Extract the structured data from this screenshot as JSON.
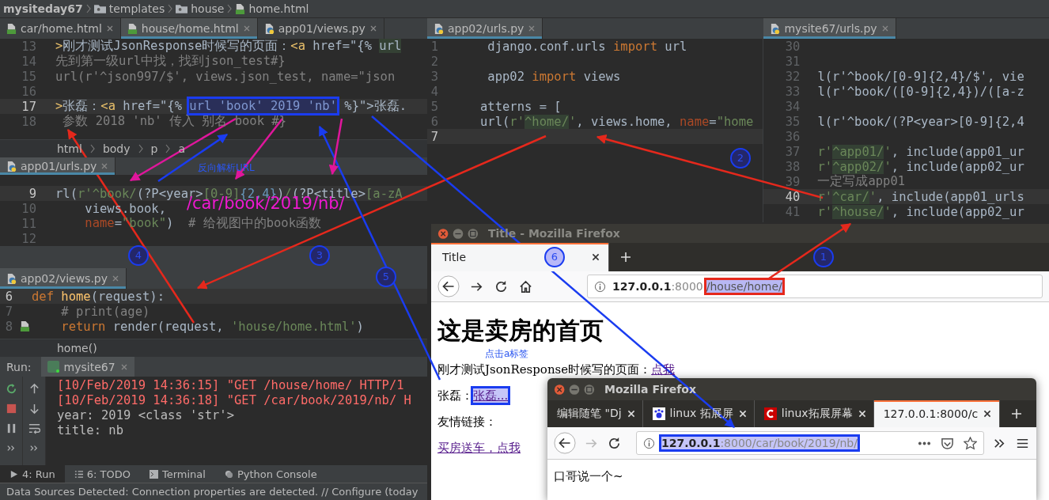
{
  "breadcrumb": [
    "mysiteday67",
    "templates",
    "house",
    "home.html"
  ],
  "editors": [
    {
      "tabs": [
        {
          "label": "car/home.html",
          "selected": false
        },
        {
          "label": "house/home.html",
          "selected": true
        },
        {
          "label": "app01/views.py",
          "selected": false
        }
      ],
      "lines": [
        {
          "num": "13",
          "current": false,
          "segments": [
            {
              "text": ">",
              "kind": "tag"
            },
            {
              "text": "刚才测试JsonResponse时候写的页面：",
              "kind": "text"
            },
            {
              "text": "<a",
              "kind": "tag"
            },
            {
              "text": " href=\"{% ",
              "kind": "text"
            },
            {
              "text": "url",
              "kind": "hl"
            }
          ]
        },
        {
          "num": "14",
          "current": false,
          "segments": [
            {
              "text": "先到第一级url中找，找到json_test#}",
              "kind": "cmt"
            }
          ]
        },
        {
          "num": "15",
          "current": false,
          "segments": [
            {
              "text": "url(r'^json997/$', views.json_test, name=\"json",
              "kind": "cmt"
            }
          ]
        },
        {
          "num": "16",
          "current": false
        },
        {
          "num": "17",
          "current": true,
          "segments": [
            {
              "text": ">",
              "kind": "tag"
            },
            {
              "text": "张磊：",
              "kind": "text"
            },
            {
              "text": "<a",
              "kind": "tag"
            },
            {
              "text": " href=\"{% ",
              "kind": "text"
            },
            {
              "text": "url 'book' 2019 'nb'",
              "kind": "hl",
              "boxed": true
            },
            {
              "text": " %}\">张磊.",
              "kind": "text"
            }
          ]
        },
        {
          "num": "18",
          "current": false,
          "segments": [
            {
              "text": " 参数 2018 'nb' 传入 别名 book #}",
              "kind": "cmt"
            }
          ]
        }
      ],
      "path": [
        "html",
        "body",
        "p",
        "a"
      ]
    },
    {
      "tabs": [
        {
          "label": "app01/urls.py",
          "selected": true
        }
      ],
      "lines": [
        {
          "num": "9",
          "current": true,
          "segments": [
            {
              "text": "rl(",
              "kind": "text"
            },
            {
              "text": "r'^book/",
              "kind": "str"
            },
            {
              "text": "(?P<year>",
              "kind": "text"
            },
            {
              "text": "[0-9]",
              "kind": "str"
            },
            {
              "text": "{2,4}",
              "kind": "num"
            },
            {
              "text": ")",
              "kind": "text"
            },
            {
              "text": "/",
              "kind": "str"
            },
            {
              "text": "(?P<title>",
              "kind": "text"
            },
            {
              "text": "[a-zA",
              "kind": "str"
            }
          ]
        },
        {
          "num": "10",
          "current": false,
          "segments": [
            {
              "text": "    views.book,",
              "kind": "text"
            }
          ]
        },
        {
          "num": "11",
          "current": false,
          "segments": [
            {
              "text": "    name",
              "kind": "param"
            },
            {
              "text": "=",
              "kind": "text"
            },
            {
              "text": "\"book\"",
              "kind": "str"
            },
            {
              "text": ")  ",
              "kind": "text"
            },
            {
              "text": "# 给视图中的book函数",
              "kind": "cmt"
            }
          ]
        },
        {
          "num": "12",
          "current": false
        }
      ]
    },
    {
      "tabs": [
        {
          "label": "app02/views.py",
          "selected": true
        }
      ],
      "lines": [
        {
          "num": "6",
          "current": true,
          "segments": [
            {
              "text": "def ",
              "kind": "kw"
            },
            {
              "text": "home",
              "kind": "fn"
            },
            {
              "text": "(request):",
              "kind": "text"
            }
          ]
        },
        {
          "num": "7",
          "current": false,
          "segments": [
            {
              "text": "    # print(age)",
              "kind": "cmt"
            }
          ]
        },
        {
          "num": "8",
          "current": false,
          "segments": [
            {
              "text": "    return ",
              "kind": "kw"
            },
            {
              "text": "render(request, ",
              "kind": "text"
            },
            {
              "text": "'house/home.html'",
              "kind": "str"
            },
            {
              "text": ")",
              "kind": "text"
            }
          ]
        }
      ],
      "footer": "home()"
    },
    {
      "tabs": [
        {
          "label": "app02/urls.py",
          "selected": true
        }
      ],
      "lines": [
        {
          "num": "1",
          "current": false,
          "segments": [
            {
              "text": " django.conf.urls ",
              "kind": "text"
            },
            {
              "text": "import",
              "kind": "kw"
            },
            {
              "text": " url",
              "kind": "text"
            }
          ]
        },
        {
          "num": "2",
          "current": false
        },
        {
          "num": "3",
          "current": false,
          "segments": [
            {
              "text": " app02 ",
              "kind": "text"
            },
            {
              "text": "import",
              "kind": "kw"
            },
            {
              "text": " views",
              "kind": "text"
            }
          ]
        },
        {
          "num": "4",
          "current": false
        },
        {
          "num": "5",
          "current": false,
          "segments": [
            {
              "text": "atterns = [",
              "kind": "text"
            }
          ]
        },
        {
          "num": "6",
          "current": false,
          "segments": [
            {
              "text": "url(",
              "kind": "text"
            },
            {
              "text": "r'",
              "kind": "str"
            },
            {
              "text": "^home/",
              "kind": "strhl"
            },
            {
              "text": "'",
              "kind": "str"
            },
            {
              "text": ", views.home, ",
              "kind": "text"
            },
            {
              "text": "name",
              "kind": "param"
            },
            {
              "text": "=",
              "kind": "text"
            },
            {
              "text": "\"home",
              "kind": "str"
            }
          ]
        },
        {
          "num": "7",
          "current": true
        }
      ]
    },
    {
      "tabs": [
        {
          "label": "mysite67/urls.py",
          "selected": true
        }
      ],
      "lines": [
        {
          "num": "30",
          "current": false
        },
        {
          "num": "31",
          "current": false
        },
        {
          "num": "32",
          "current": false,
          "segments": [
            {
              "text": "l(r'^book/[0-9]{2,4}/$', vie",
              "kind": "text"
            }
          ]
        },
        {
          "num": "33",
          "current": false,
          "segments": [
            {
              "text": "l(r'^book/([0-9]{2,4})/([a-z",
              "kind": "text"
            }
          ]
        },
        {
          "num": "34",
          "current": false
        },
        {
          "num": "35",
          "current": false,
          "segments": [
            {
              "text": "l(r'^book/(?P<year>[0-9]{2,4",
              "kind": "text"
            }
          ]
        },
        {
          "num": "36",
          "current": false
        },
        {
          "num": "37",
          "current": false,
          "segments": [
            {
              "text": "r'",
              "kind": "str"
            },
            {
              "text": "^app01/",
              "kind": "strhl"
            },
            {
              "text": "'",
              "kind": "str"
            },
            {
              "text": ", include(app01_ur",
              "kind": "text"
            }
          ]
        },
        {
          "num": "38",
          "current": false,
          "segments": [
            {
              "text": "r'",
              "kind": "str"
            },
            {
              "text": "^app02/",
              "kind": "strhl"
            },
            {
              "text": "'",
              "kind": "str"
            },
            {
              "text": ", include(app02_ur",
              "kind": "text"
            }
          ]
        },
        {
          "num": "39",
          "current": false,
          "segments": [
            {
              "text": "一定写成app01",
              "kind": "cmt"
            }
          ]
        },
        {
          "num": "40",
          "current": true,
          "segments": [
            {
              "text": "r'",
              "kind": "str"
            },
            {
              "text": "^car/",
              "kind": "strhl"
            },
            {
              "text": "'",
              "kind": "str"
            },
            {
              "text": ", include(app01_urls",
              "kind": "text"
            }
          ]
        },
        {
          "num": "41",
          "current": false,
          "segments": [
            {
              "text": "r'",
              "kind": "str"
            },
            {
              "text": "^house/",
              "kind": "strhl"
            },
            {
              "text": "'",
              "kind": "str"
            },
            {
              "text": ", include(app02_ur",
              "kind": "text"
            }
          ]
        }
      ]
    }
  ],
  "run": {
    "label": "Run:",
    "tab": "mysite67",
    "console": [
      {
        "text": "[10/Feb/2019 14:36:15] \"GET /house/home/ HTTP/1",
        "kind": "err"
      },
      {
        "text": "[10/Feb/2019 14:36:18] \"GET /car/book/2019/nb/ H",
        "kind": "err"
      },
      {
        "text": "year: 2019 <class 'str'>",
        "kind": "out"
      },
      {
        "text": "title: nb",
        "kind": "out"
      }
    ]
  },
  "tool_tabs": [
    {
      "label": "4: Run",
      "selected": true
    },
    {
      "label": "6: TODO",
      "selected": false
    },
    {
      "label": "Terminal",
      "selected": false
    },
    {
      "label": "Python Console",
      "selected": false
    }
  ],
  "status_bar": "Data Sources Detected: Connection properties are detected. // Configure (today",
  "browsers": [
    {
      "title": "Title - Mozilla Firefox",
      "tabs": [
        {
          "label": "Title",
          "selected": true
        }
      ],
      "url": {
        "host": "127.0.0.1",
        "rest": ":8000",
        "path": "/house/home/",
        "boxed": true
      },
      "page": {
        "heading": "这是卖房的首页",
        "paragraphs": [
          {
            "label": "刚才测试JsonResponse时候写的页面：",
            "link": "点我",
            "boxed": false
          },
          {
            "label": "张磊：",
            "link": "张磊...",
            "boxed": true
          },
          {
            "label": "友情链接："
          },
          {
            "link": "买房送车，点我",
            "boxed": false
          }
        ]
      }
    },
    {
      "title": "Mozilla Firefox",
      "tabs": [
        {
          "label": "编辑随笔 \"Dj",
          "selected": false
        },
        {
          "label": "linux 拓展屏",
          "selected": false
        },
        {
          "label": "linux拓展屏幕",
          "selected": false
        },
        {
          "label": "127.0.0.1:8000/c",
          "selected": true
        }
      ],
      "url": {
        "host": "127.0.0.1",
        "rest": ":8000/car/book/2019/nb/",
        "boxed": true
      },
      "page": {
        "text": "口哥说一个~"
      }
    }
  ],
  "annotations": {
    "steps": [
      {
        "label": "2",
        "highlighted": false
      },
      {
        "label": "4",
        "highlighted": false
      },
      {
        "label": "3",
        "highlighted": false
      },
      {
        "label": "6",
        "highlighted": true
      },
      {
        "label": "1",
        "highlighted": false
      },
      {
        "label": "5",
        "highlighted": false
      }
    ],
    "notes": [
      {
        "text": "反向解析URL",
        "kind": "caption"
      },
      {
        "text": "/car/book/2019/nb/",
        "kind": "resolved-url"
      },
      {
        "text": "点击a标签",
        "kind": "caption"
      }
    ]
  }
}
